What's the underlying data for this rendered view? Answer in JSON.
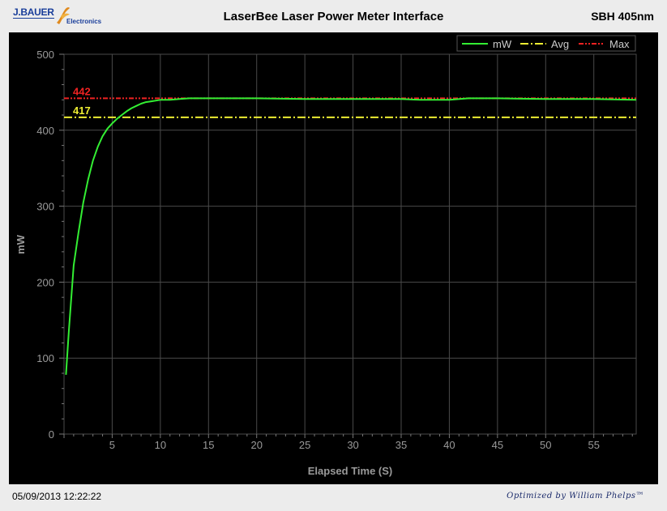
{
  "header": {
    "logo_text": "J.BAUER",
    "logo_sub": "Electronics",
    "app_title": "LaserBee Laser Power Meter Interface",
    "device_label": "SBH 405nm"
  },
  "footer": {
    "timestamp": "05/09/2013 12:22:22",
    "credit": "Optimized by William Phelps™"
  },
  "colors": {
    "background": "#000000",
    "grid": "#4a4a4a",
    "axis_text": "#9a9a9a",
    "series_mw": "#33ee33",
    "avg_line": "#eeee33",
    "max_line": "#ee2222"
  },
  "chart_data": {
    "type": "line",
    "xlabel": "Elapsed Time (S)",
    "ylabel": "mW",
    "xlim": [
      0,
      59.4
    ],
    "ylim": [
      0,
      500
    ],
    "x_ticks": [
      5,
      10,
      15,
      20,
      25,
      30,
      35,
      40,
      45,
      50,
      55
    ],
    "y_ticks": [
      0,
      100,
      200,
      300,
      400,
      500
    ],
    "grid": true,
    "legend_position": "top-right",
    "legend": [
      "mW",
      "Avg",
      "Max"
    ],
    "series": [
      {
        "name": "mW",
        "x": [
          0.2,
          0.5,
          1,
          1.5,
          2,
          2.5,
          3,
          3.5,
          4,
          4.5,
          5,
          5.5,
          6,
          6.5,
          7,
          7.5,
          8,
          8.5,
          9,
          10,
          11,
          12,
          13,
          14,
          15,
          20,
          25,
          30,
          35,
          37,
          40,
          42,
          45,
          50,
          55,
          59.4
        ],
        "y": [
          78,
          135,
          222,
          265,
          305,
          335,
          360,
          378,
          392,
          402,
          409,
          415,
          420,
          425,
          429,
          432,
          435,
          437,
          438,
          440,
          440,
          441,
          442,
          442,
          442,
          442,
          441,
          441,
          441,
          440,
          440,
          442,
          442,
          441,
          441,
          440
        ]
      }
    ],
    "reference_lines": [
      {
        "name": "Avg",
        "value": 417,
        "label": "417"
      },
      {
        "name": "Max",
        "value": 442,
        "label": "442"
      }
    ]
  }
}
